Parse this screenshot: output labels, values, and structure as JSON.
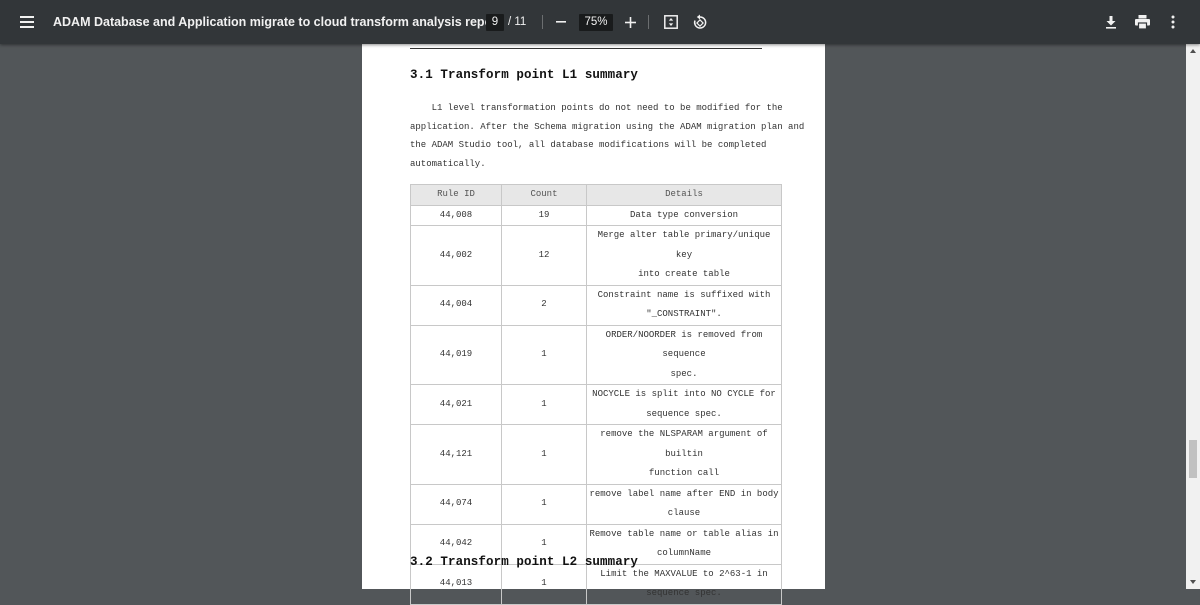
{
  "toolbar": {
    "title": "ADAM Database and Application migrate to cloud transform analysis report",
    "current_page": "9",
    "total_pages": "/ 11",
    "zoom": "75%",
    "icons": [
      "menu-icon",
      "zoom-out-icon",
      "zoom-in-icon",
      "fit-page-icon",
      "rotate-icon",
      "download-icon",
      "print-icon",
      "more-options-icon"
    ]
  },
  "page": {
    "heading_l1": "3.1 Transform point L1 summary",
    "paragraph_lines": [
      "    L1 level transformation points do not need to be modified for the",
      "application. After the Schema migration using the ADAM migration plan and",
      "the ADAM Studio tool, all database modifications will be completed",
      "automatically."
    ],
    "table": {
      "headers": [
        "Rule ID",
        "Count",
        "Details"
      ],
      "rows": [
        {
          "id": "44,008",
          "count": "19",
          "details": [
            "Data type conversion"
          ]
        },
        {
          "id": "44,002",
          "count": "12",
          "details": [
            "Merge alter table primary/unique key",
            "into create table"
          ]
        },
        {
          "id": "44,004",
          "count": "2",
          "details": [
            "Constraint name is suffixed with",
            "\"_CONSTRAINT\"."
          ]
        },
        {
          "id": "44,019",
          "count": "1",
          "details": [
            "ORDER/NOORDER is removed from sequence",
            "spec."
          ]
        },
        {
          "id": "44,021",
          "count": "1",
          "details": [
            "NOCYCLE is split into NO CYCLE for",
            "sequence spec."
          ]
        },
        {
          "id": "44,121",
          "count": "1",
          "details": [
            "remove the NLSPARAM argument of builtin",
            "function call"
          ]
        },
        {
          "id": "44,074",
          "count": "1",
          "details": [
            "remove label name after END in body",
            "clause"
          ]
        },
        {
          "id": "44,042",
          "count": "1",
          "details": [
            "Remove table name or table alias in",
            "columnName"
          ]
        },
        {
          "id": "44,013",
          "count": "1",
          "details": [
            "Limit the MAXVALUE to 2^63-1 in",
            "sequence spec."
          ]
        }
      ]
    },
    "heading_l2": "3.2 Transform point L2 summary"
  },
  "colors": {
    "toolbar_bg": "#323639",
    "viewer_bg": "#525659",
    "page_bg": "#ffffff",
    "table_header_bg": "#e7e7e7"
  }
}
